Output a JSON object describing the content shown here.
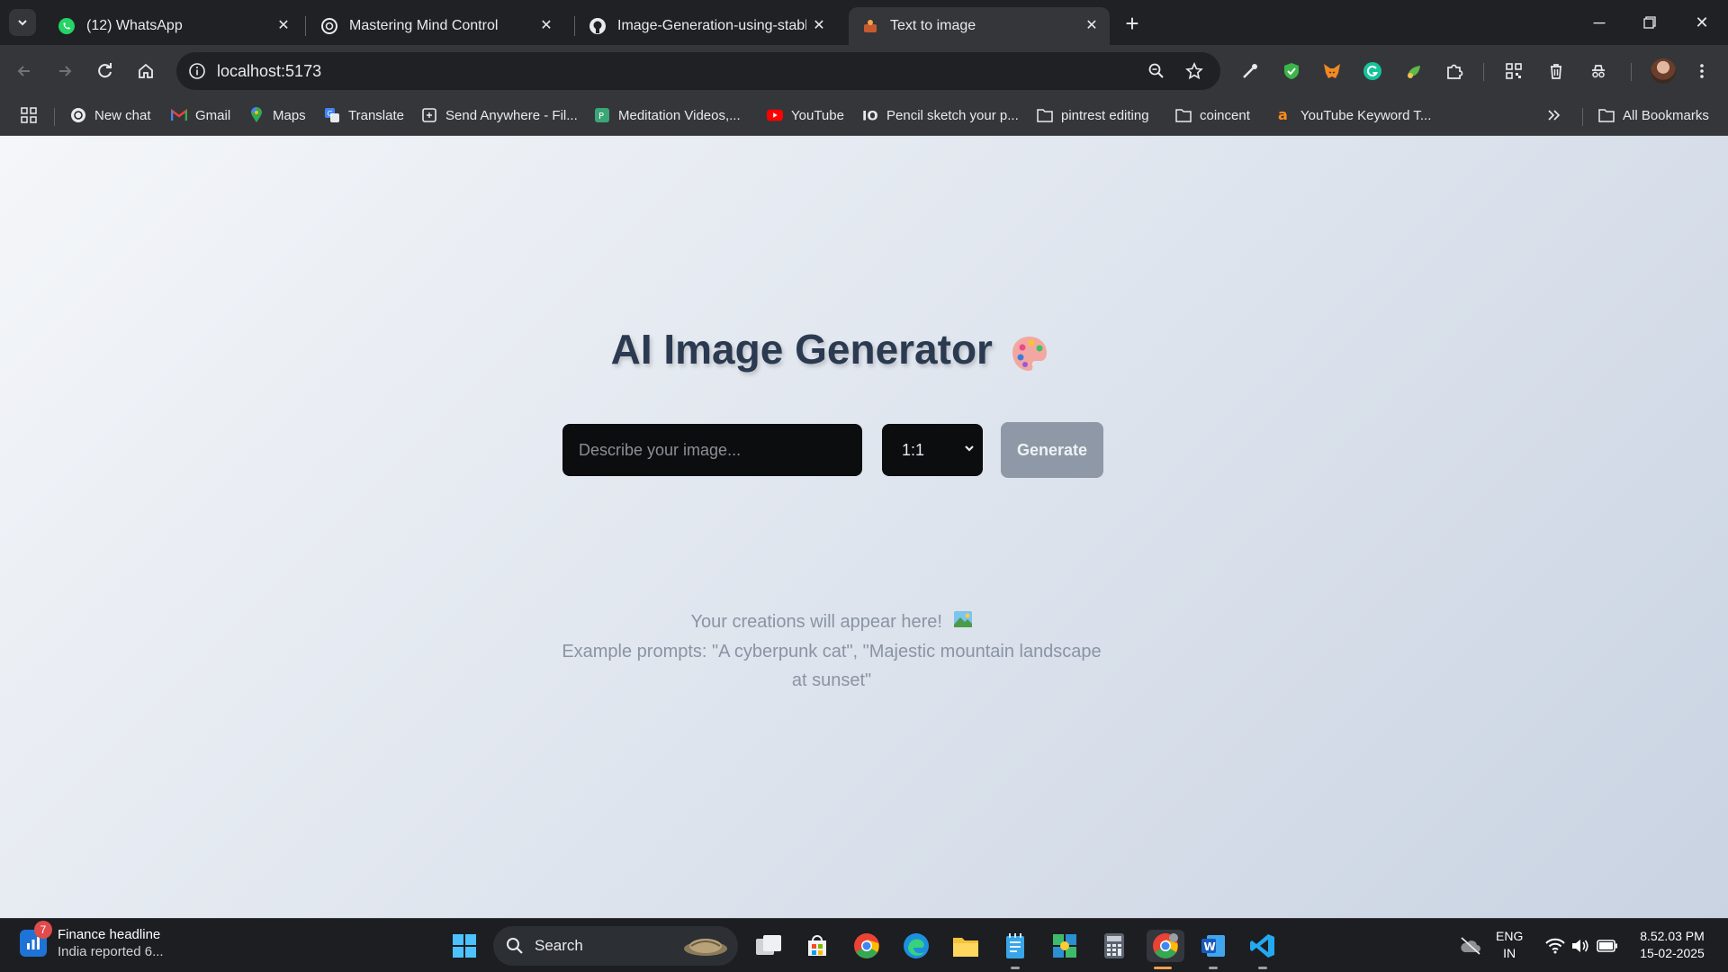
{
  "browser": {
    "tabs": [
      {
        "title": "(12) WhatsApp",
        "favicon": "whatsapp-icon",
        "active": false
      },
      {
        "title": "Mastering Mind Control",
        "favicon": "openai-icon",
        "active": false
      },
      {
        "title": "Image-Generation-using-stable",
        "favicon": "github-icon",
        "active": false
      },
      {
        "title": "Text to image",
        "favicon": "site-icon",
        "active": true
      }
    ],
    "url": "localhost:5173",
    "bookmarks": [
      {
        "label": "New chat",
        "icon": "openai-icon"
      },
      {
        "label": "Gmail",
        "icon": "gmail-icon"
      },
      {
        "label": "Maps",
        "icon": "maps-icon"
      },
      {
        "label": "Translate",
        "icon": "translate-icon"
      },
      {
        "label": "Send Anywhere - Fil...",
        "icon": "send-anywhere-icon"
      },
      {
        "label": "Meditation Videos,...",
        "icon": "meditation-icon"
      },
      {
        "label": "YouTube",
        "icon": "youtube-icon"
      },
      {
        "label": "Pencil sketch your p...",
        "icon": "io-icon"
      },
      {
        "label": "pintrest editing",
        "icon": "folder-icon"
      },
      {
        "label": "coincent",
        "icon": "folder-icon"
      },
      {
        "label": "YouTube Keyword T...",
        "icon": "ahrefs-icon"
      }
    ],
    "all_bookmarks": "All Bookmarks"
  },
  "app": {
    "title": "AI Image Generator",
    "title_emoji": "palette-icon",
    "prompt_placeholder": "Describe your image...",
    "prompt_value": "",
    "aspect_ratio": "1:1",
    "generate_label": "Generate",
    "hint_line1": "Your creations will appear here!",
    "hint_line2": "Example prompts: \"A cyberpunk cat\", \"Majestic mountain landscape at sunset\""
  },
  "taskbar": {
    "news_headline": "Finance headline",
    "news_sub": "India reported 6...",
    "news_badge": "7",
    "search_label": "Search",
    "lang_line1": "ENG",
    "lang_line2": "IN",
    "time": "8.52.03 PM",
    "date": "15-02-2025"
  },
  "colors": {
    "accent_title": "#2b3a50",
    "generate_button": "#8e98a6",
    "input_bg": "#0c0d0f"
  }
}
